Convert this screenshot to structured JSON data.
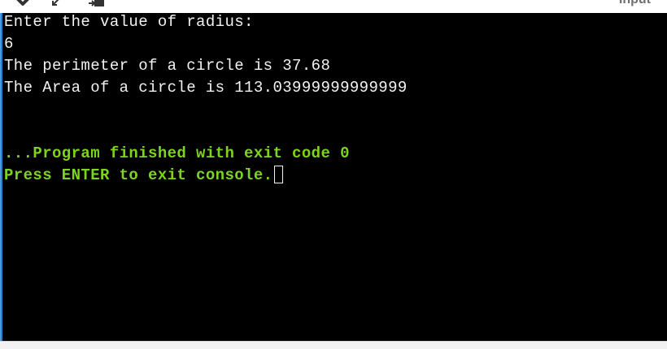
{
  "toolbar": {
    "input_label": "Input",
    "icons": [
      "check-icon",
      "resize-icon",
      "open-icon"
    ]
  },
  "console": {
    "output_lines": [
      "Enter the value of radius:",
      "6",
      "The perimeter of a circle is 37.68",
      "The Area of a circle is 113.03999999999999"
    ],
    "status_lines": [
      "...Program finished with exit code 0",
      "Press ENTER to exit console."
    ]
  },
  "colors": {
    "console_bg": "#000000",
    "output_text": "#f2f2f2",
    "status_text": "#7ed321",
    "frame_edge": "#2f7fc8"
  }
}
